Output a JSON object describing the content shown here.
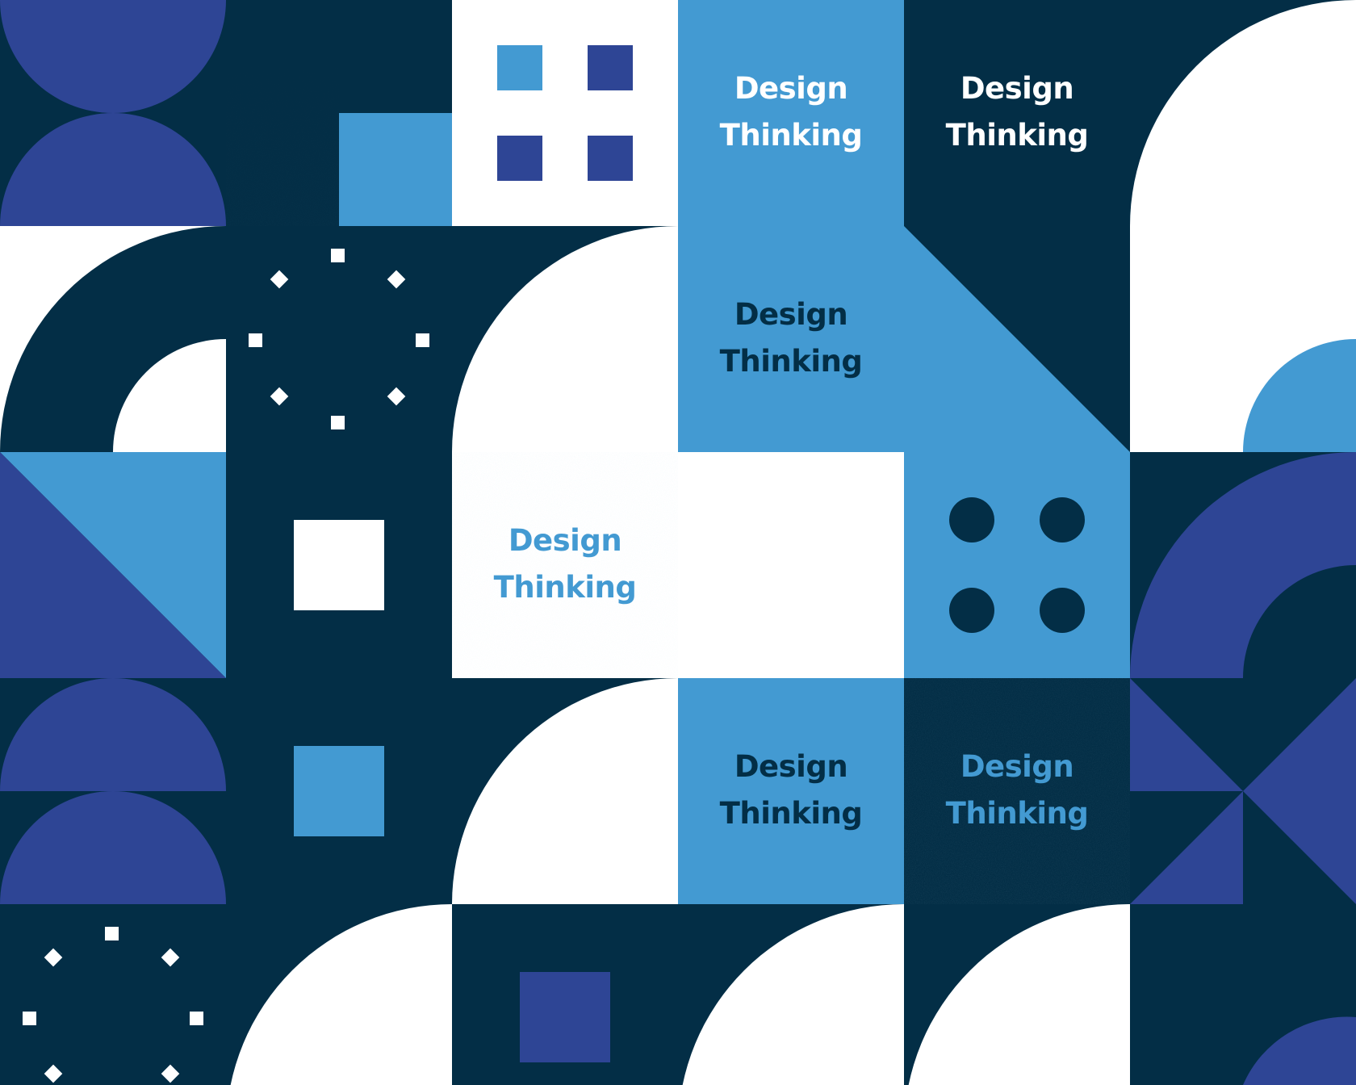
{
  "colors": {
    "navy": "#032e46",
    "indigo": "#2e4595",
    "sky": "#439ad2",
    "white": "#ffffff"
  },
  "labels": [
    {
      "line1": "Design",
      "line2": "Thinking",
      "color": "#ffffff"
    },
    {
      "line1": "Design",
      "line2": "Thinking",
      "color": "#ffffff"
    },
    {
      "line1": "Design",
      "line2": "Thinking",
      "color": "#032e46"
    },
    {
      "line1": "Design",
      "line2": "Thinking",
      "color": "#439ad2"
    },
    {
      "line1": "Design",
      "line2": "Thinking",
      "color": "#032e46"
    },
    {
      "line1": "Design",
      "line2": "Thinking",
      "color": "#439ad2"
    }
  ]
}
